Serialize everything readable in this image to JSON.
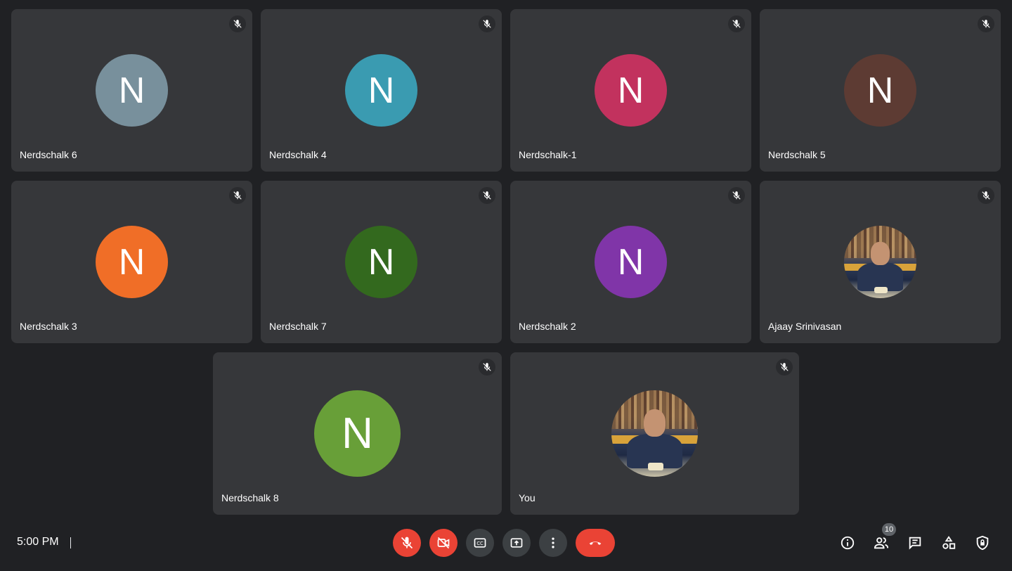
{
  "participants": [
    {
      "name": "Nerdschalk 6",
      "initial": "N",
      "color": "#78909c"
    },
    {
      "name": "Nerdschalk 4",
      "initial": "N",
      "color": "#3a9bb1"
    },
    {
      "name": "Nerdschalk-1",
      "initial": "N",
      "color": "#c2325e"
    },
    {
      "name": "Nerdschalk 5",
      "initial": "N",
      "color": "#5d3b33"
    },
    {
      "name": "Nerdschalk 3",
      "initial": "N",
      "color": "#f06e27"
    },
    {
      "name": "Nerdschalk 7",
      "initial": "N",
      "color": "#33691e"
    },
    {
      "name": "Nerdschalk 2",
      "initial": "N",
      "color": "#8035a8"
    },
    {
      "name": "Ajaay Srinivasan",
      "initial": "",
      "color": "#000000"
    },
    {
      "name": "Nerdschalk 8",
      "initial": "N",
      "color": "#689f38"
    },
    {
      "name": "You",
      "initial": "",
      "color": "#000000"
    }
  ],
  "bottom_bar": {
    "time": "5:00 PM",
    "participant_count": "10"
  },
  "colors": {
    "background": "#202124",
    "tile": "#36373a",
    "control": "#3c4043",
    "danger": "#ea4335"
  }
}
